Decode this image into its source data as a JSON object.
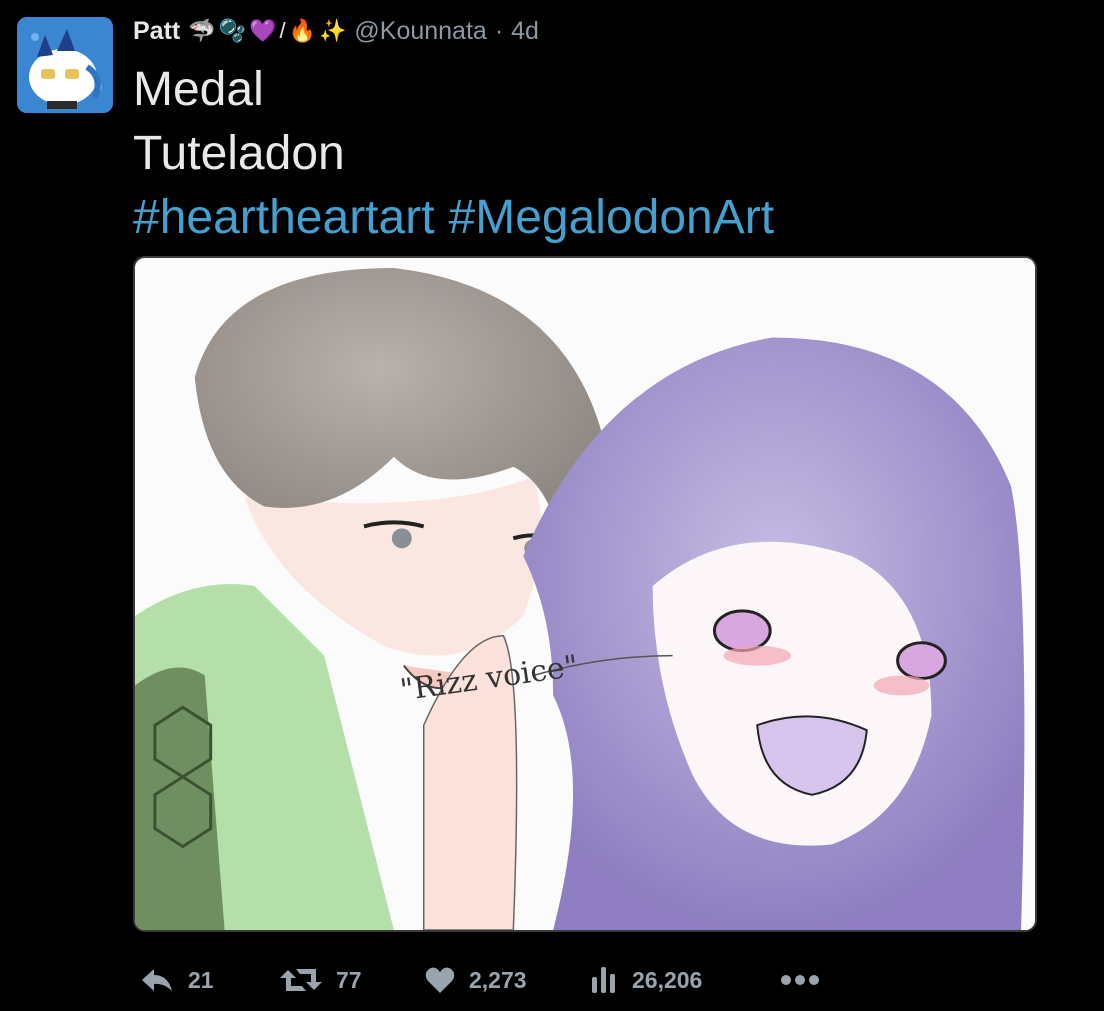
{
  "tweet": {
    "display_name": "Patt",
    "name_emojis": [
      "🦈",
      "🫧",
      "💜",
      "/",
      "🔥",
      "✨"
    ],
    "handle": "@Kounnata",
    "separator": "·",
    "time": "4d",
    "text_lines": [
      "Medal",
      "Tuteladon"
    ],
    "hashtags": [
      "#heartheartart",
      "#MegalodonArt"
    ],
    "media_caption_text": "\"Rizz voice\""
  },
  "actions": {
    "replies": "21",
    "retweets": "77",
    "likes": "2,273",
    "views": "26,206"
  },
  "colors": {
    "background": "#000000",
    "link": "#45a0cf",
    "muted": "#8b98a5",
    "icon": "#9aa4ae"
  },
  "icons": {
    "reply": "reply-icon",
    "retweet": "retweet-icon",
    "like": "heart-icon",
    "views": "views-icon",
    "more": "more-icon"
  }
}
